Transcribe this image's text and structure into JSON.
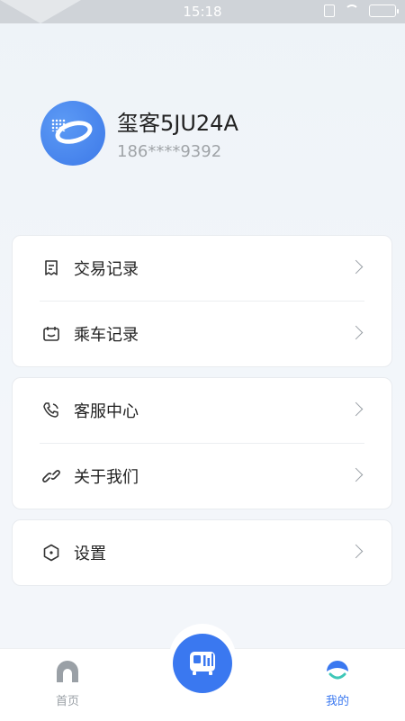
{
  "status_bar": {
    "time": "15:18"
  },
  "profile": {
    "name": "玺客5JU24A",
    "phone": "186****9392"
  },
  "menu_groups": [
    [
      {
        "label": "交易记录",
        "icon": "receipt-icon"
      },
      {
        "label": "乘车记录",
        "icon": "calendar-ride-icon"
      }
    ],
    [
      {
        "label": "客服中心",
        "icon": "phone-service-icon"
      },
      {
        "label": "关于我们",
        "icon": "link-icon"
      }
    ],
    [
      {
        "label": "设置",
        "icon": "hexagon-settings-icon"
      }
    ]
  ],
  "tab_bar": {
    "tabs": [
      {
        "label": "首页",
        "icon": "home-arch-icon",
        "active": false
      },
      {
        "label": "我的",
        "icon": "profile-tab-icon",
        "active": true
      }
    ],
    "center_icon": "bus-scan-icon"
  },
  "colors": {
    "accent": "#3a78f0",
    "active_tab": "#3a78f0",
    "inactive_tab": "#9aa0a6",
    "teal": "#3ec7b8"
  }
}
